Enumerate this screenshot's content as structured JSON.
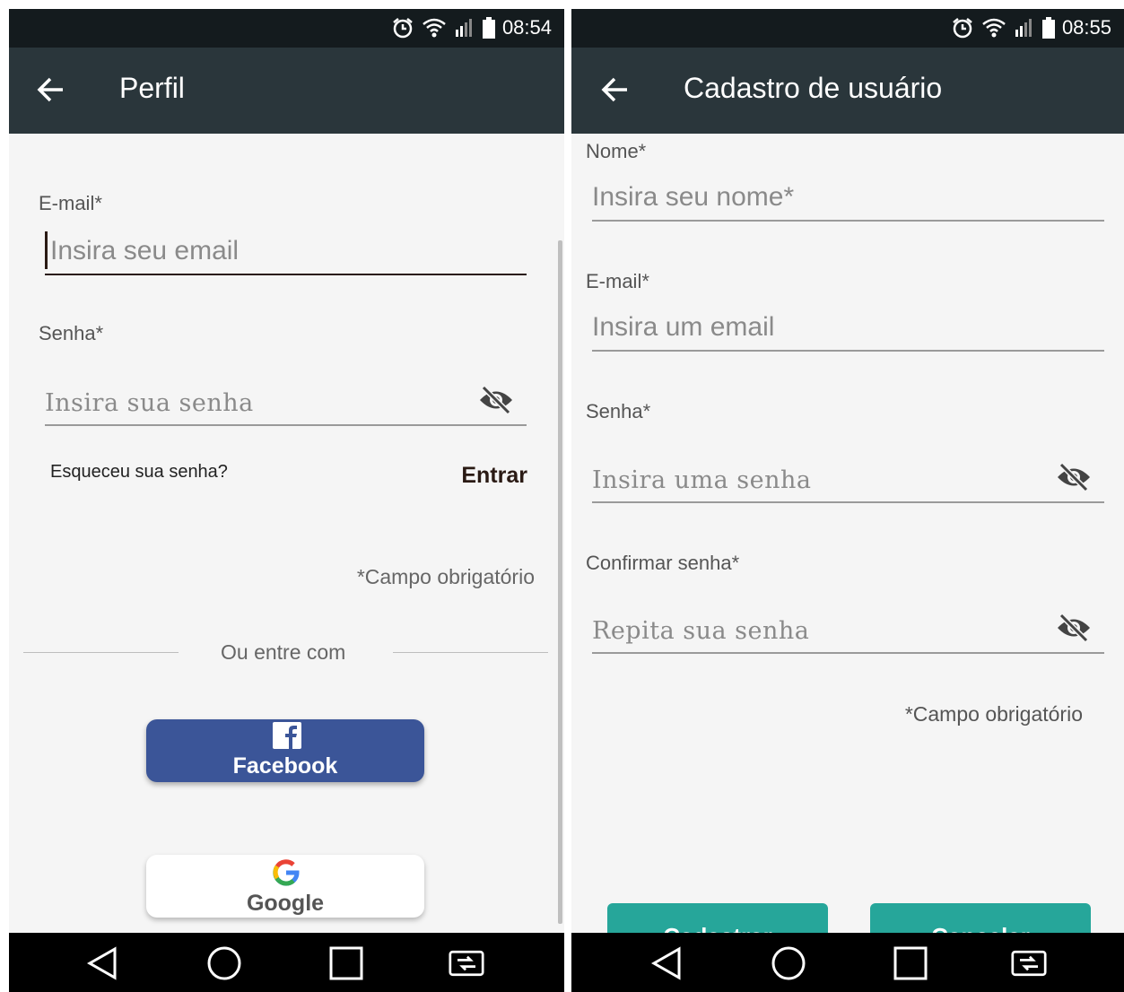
{
  "left": {
    "status": {
      "time": "08:54"
    },
    "toolbar": {
      "title": "Perfil"
    },
    "email": {
      "label": "E-mail*",
      "placeholder": "Insira seu email"
    },
    "password": {
      "label": "Senha*",
      "placeholder": "Insira sua senha"
    },
    "forgot": "Esqueceu sua senha?",
    "login": "Entrar",
    "required_note": "*Campo obrigatório",
    "divider_text": "Ou entre com",
    "facebook": {
      "label": "Facebook",
      "color": "#3b5598"
    },
    "google": {
      "label": "Google"
    }
  },
  "right": {
    "status": {
      "time": "08:55"
    },
    "toolbar": {
      "title": "Cadastro de usuário"
    },
    "name": {
      "label": "Nome*",
      "placeholder": "Insira seu nome*"
    },
    "email": {
      "label": "E-mail*",
      "placeholder": "Insira um email"
    },
    "password": {
      "label": "Senha*",
      "placeholder": "Insira uma senha"
    },
    "confirm": {
      "label": "Confirmar senha*",
      "placeholder": "Repita sua senha"
    },
    "required_note": "*Campo obrigatório",
    "register_button": {
      "label": "Cadastrar",
      "color": "#26a69a"
    },
    "cancel_button": {
      "label": "Cancelar",
      "color": "#26a69a"
    }
  },
  "icons": {
    "status": [
      "alarm-icon",
      "wifi-icon",
      "signal-icon",
      "battery-icon"
    ],
    "nav": [
      "back-triangle-icon",
      "home-circle-icon",
      "recents-square-icon",
      "switch-app-icon"
    ]
  }
}
